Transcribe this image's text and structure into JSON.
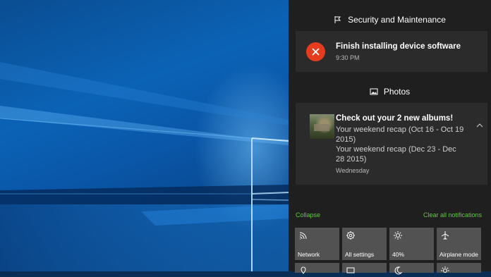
{
  "action_center": {
    "groups": [
      {
        "app": "Security and Maintenance",
        "icon": "flag-icon",
        "notifications": [
          {
            "title": "Finish installing device software",
            "time": "9:30 PM",
            "icon": "error-x-icon",
            "accent": "#e53c1f"
          }
        ]
      },
      {
        "app": "Photos",
        "icon": "photo-icon",
        "notifications": [
          {
            "title": "Check out your 2 new albums!",
            "lines": [
              "Your weekend recap (Oct 16 - Oct 19",
              "2015)",
              "Your weekend recap (Dec 23 - Dec",
              "28 2015)"
            ],
            "time": "Wednesday",
            "icon": "album-thumbnail"
          }
        ]
      }
    ],
    "collapse_label": "Collapse",
    "clear_all_label": "Clear all notifications",
    "link_color": "#5fcc3a",
    "quick_actions": [
      {
        "label": "Network",
        "icon": "network-icon"
      },
      {
        "label": "All settings",
        "icon": "gear-icon"
      },
      {
        "label": "40%",
        "icon": "brightness-icon"
      },
      {
        "label": "Airplane mode",
        "icon": "airplane-icon"
      }
    ],
    "quick_actions_row2_icons": [
      "location-icon",
      "project-icon",
      "quiet-hours-icon",
      "brightness2-icon"
    ]
  }
}
